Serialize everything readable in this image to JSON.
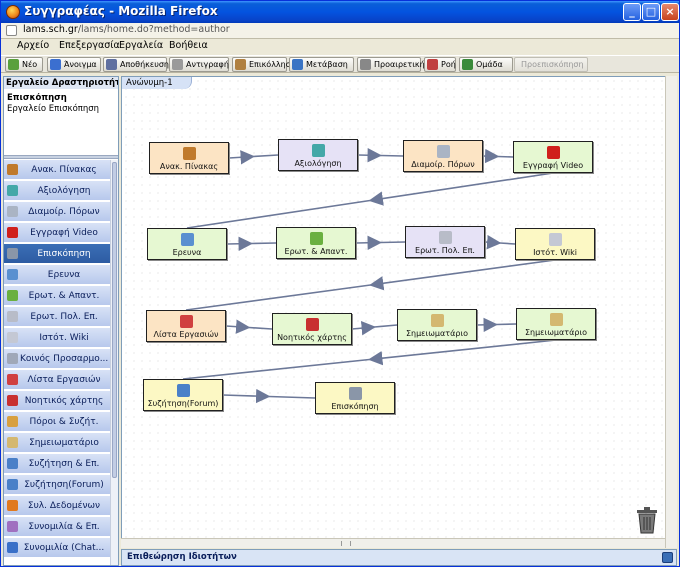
{
  "window": {
    "title": "Συγγραφέας - Mozilla Firefox",
    "url_domain": "lams.sch.gr",
    "url_path": "/lams/home.do?method=author",
    "buttons": {
      "minimize": "_",
      "maximize": "□",
      "close": "×"
    }
  },
  "menu": [
    "Αρχείο",
    "Επεξεργασία",
    "Εργαλεία",
    "Βοήθεια"
  ],
  "toolbar": [
    {
      "label": "Νέο",
      "icon": "new-file-icon",
      "color": "#5aa03c"
    },
    {
      "label": "Άνοιγμα",
      "icon": "open-folder-icon",
      "color": "#3b6fd0"
    },
    {
      "label": "Αποθήκευση",
      "icon": "save-icon",
      "color": "#6070a0"
    },
    {
      "label": "Αντιγραφή",
      "icon": "copy-icon",
      "color": "#9a9a9a"
    },
    {
      "label": "Επικόλληση",
      "icon": "paste-icon",
      "color": "#b08040"
    },
    {
      "label": "Μετάβαση",
      "icon": "transition-icon",
      "color": "#3a74c4"
    },
    {
      "label": "Προαιρετική",
      "icon": "optional-icon",
      "color": "#888888"
    },
    {
      "label": "Ροή",
      "icon": "flow-icon",
      "color": "#c04040"
    },
    {
      "label": "Ομάδα",
      "icon": "group-icon",
      "color": "#3a8a3a"
    },
    {
      "label": "Προεπισκόπηση",
      "icon": "",
      "color": "",
      "disabled": true
    }
  ],
  "left_panel": {
    "title": "Εργαλείο Δραστηριοτήτων",
    "description_title": "Επισκόπηση",
    "description_text": "Εργαλείο Επισκόπηση",
    "palette": [
      {
        "label": "Ανακ. Πίνακας",
        "color": "#c07a2c"
      },
      {
        "label": "Αξιολόγηση",
        "color": "#44a8a8"
      },
      {
        "label": "Διαμοίρ. Πόρων",
        "color": "#aab4c4"
      },
      {
        "label": "Εγγραφή Video",
        "color": "#d0201c"
      },
      {
        "label": "Επισκόπηση",
        "color": "#8a96a8",
        "selected": true
      },
      {
        "label": "Ερευνα",
        "color": "#5a90d0"
      },
      {
        "label": "Ερωτ. & Απαντ.",
        "color": "#6ab040"
      },
      {
        "label": "Ερωτ. Πολ. Επ.",
        "color": "#b8bcc8"
      },
      {
        "label": "Ιστότ. Wiki",
        "color": "#c4c8d4"
      },
      {
        "label": "Κοινός Προσαρμο...",
        "color": "#a0a8b8"
      },
      {
        "label": "Λίστα Εργασιών",
        "color": "#d04040"
      },
      {
        "label": "Νοητικός χάρτης",
        "color": "#c83030"
      },
      {
        "label": "Πόροι & Συζήτ.",
        "color": "#d8a040"
      },
      {
        "label": "Σημειωματάριο",
        "color": "#d4b870"
      },
      {
        "label": "Συζήτηση & Επ.",
        "color": "#4a80c8"
      },
      {
        "label": "Συζήτηση(Forum)",
        "color": "#4a80c8"
      },
      {
        "label": "Συλ. Δεδομένων",
        "color": "#e07a20"
      },
      {
        "label": "Συνομιλία & Επ.",
        "color": "#a070c0"
      },
      {
        "label": "Συνομιλία (Chat...",
        "color": "#3a70c8"
      }
    ]
  },
  "canvas": {
    "tab": "Ανώνυμη-1",
    "activities": [
      {
        "label": "Ανακ. Πίνακας",
        "fill": "#fce4c4",
        "icon_color": "#c07a2c"
      },
      {
        "label": "Αξιολόγηση",
        "fill": "#e6e2f6",
        "icon_color": "#44a8a8"
      },
      {
        "label": "Διαμοίρ. Πόρων",
        "fill": "#fce4c4",
        "icon_color": "#aab4c4"
      },
      {
        "label": "Εγγραφή Video",
        "fill": "#e6f8d2",
        "icon_color": "#d0201c"
      },
      {
        "label": "Ερευνα",
        "fill": "#e6f8d2",
        "icon_color": "#5a90d0"
      },
      {
        "label": "Ερωτ. & Απαντ.",
        "fill": "#e6f8d2",
        "icon_color": "#6ab040"
      },
      {
        "label": "Ερωτ. Πολ. Επ.",
        "fill": "#e6e2f6",
        "icon_color": "#b8bcc8"
      },
      {
        "label": "Ιστότ. Wiki",
        "fill": "#fcf8c4",
        "icon_color": "#c4c8d4"
      },
      {
        "label": "Λίστα Εργασιών",
        "fill": "#fce4c4",
        "icon_color": "#d04040"
      },
      {
        "label": "Νοητικός χάρτης",
        "fill": "#e6f8d2",
        "icon_color": "#c83030"
      },
      {
        "label": "Σημειωματάριο",
        "fill": "#e6f8d2",
        "icon_color": "#d4b870"
      },
      {
        "label": "Σημειωματάριο",
        "fill": "#e6f8d2",
        "icon_color": "#d4b870"
      },
      {
        "label": "Συζήτηση(Forum)",
        "fill": "#fcf8c4",
        "icon_color": "#4a80c8"
      },
      {
        "label": "Επισκόπηση",
        "fill": "#fcf8c4",
        "icon_color": "#8a96a8"
      }
    ],
    "transitions": [
      [
        0,
        1
      ],
      [
        1,
        2
      ],
      [
        2,
        3
      ],
      [
        3,
        4
      ],
      [
        4,
        5
      ],
      [
        5,
        6
      ],
      [
        6,
        7
      ],
      [
        7,
        8
      ],
      [
        8,
        9
      ],
      [
        9,
        10
      ],
      [
        10,
        11
      ],
      [
        11,
        12
      ],
      [
        12,
        13
      ]
    ]
  },
  "properties_panel": {
    "title": "Επιθεώρηση Ιδιοτήτων"
  },
  "colors": {
    "transition_line": "#6c7898",
    "selected_item": "#2d5ca3"
  }
}
